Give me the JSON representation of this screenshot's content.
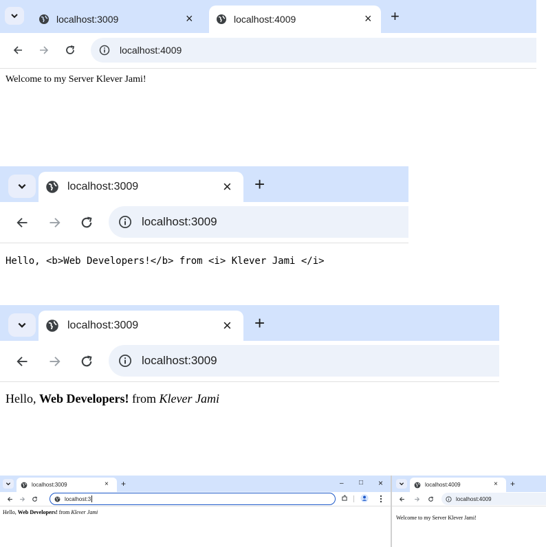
{
  "panel1": {
    "tabs": [
      {
        "label": "localhost:3009",
        "active": false
      },
      {
        "label": "localhost:4009",
        "active": true
      }
    ],
    "new_tab": "+",
    "close": "×",
    "address": "localhost:4009",
    "content": "Welcome to my Server Klever Jami!"
  },
  "panel2": {
    "tab": "localhost:3009",
    "new_tab": "+",
    "close": "×",
    "address": "localhost:3009",
    "content": "Hello, <b>Web Developers!</b> from <i> Klever Jami </i>"
  },
  "panel3": {
    "tab": "localhost:3009",
    "new_tab": "+",
    "close": "×",
    "address": "localhost:3009",
    "content": {
      "prefix": "Hello, ",
      "bold": "Web Developers!",
      "middle": " from ",
      "italic": "Klever Jami"
    }
  },
  "panel4": {
    "left": {
      "tab": "localhost:3009",
      "new_tab": "+",
      "close": "×",
      "address_input": "localhost:3",
      "window_controls": {
        "minimize": "–",
        "maximize": "□",
        "close": "×"
      },
      "content": {
        "prefix": "Hello, ",
        "bold": "Web Developers!",
        "middle": " from ",
        "italic": "Klever Jami"
      }
    },
    "right": {
      "tab": "localhost:4009",
      "new_tab": "+",
      "close": "×",
      "address": "localhost:4009",
      "content": "Welcome to my Server Klever Jami!"
    }
  },
  "icons": {
    "chevron": "chevron-down-icon",
    "globe": "globe-icon",
    "back": "back-arrow-icon",
    "forward": "forward-arrow-icon",
    "reload": "reload-icon",
    "info": "info-icon"
  }
}
